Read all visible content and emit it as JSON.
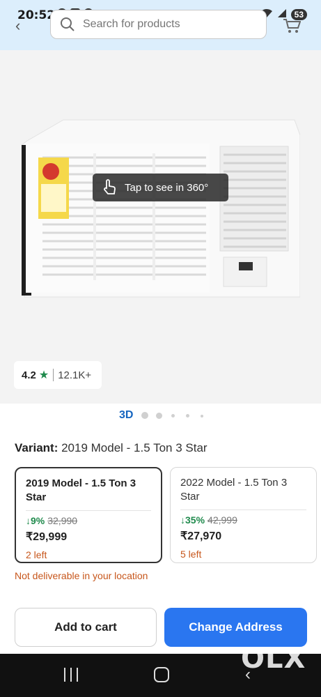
{
  "status_bar": {
    "time": "20:52",
    "battery": "53"
  },
  "header": {
    "search_placeholder": "Search for products"
  },
  "gallery": {
    "tap_360_label": "Tap to see in 360°",
    "rating": "4.2",
    "rating_star": "★",
    "rating_count": "12.1K+",
    "pager_label": "3D"
  },
  "variant": {
    "label": "Variant:",
    "selected": "2019 Model  -  1.5 Ton 3 Star",
    "options": [
      {
        "name": "2019 Model  -  1.5 Ton 3 Star",
        "discount": "↓9%",
        "mrp": "32,990",
        "price": "₹29,999",
        "stock": "2 left",
        "selected": true
      },
      {
        "name": "2022 Model  -  1.5 Ton 3 Star",
        "discount": "↓35%",
        "mrp": "42,999",
        "price": "₹27,970",
        "stock": "5 left",
        "selected": false
      }
    ]
  },
  "delivery_notice": "Not deliverable in your location",
  "actions": {
    "add_to_cart": "Add to cart",
    "change_address": "Change Address"
  },
  "watermark": "OLX",
  "colors": {
    "primary": "#2a76f0",
    "discount_green": "#1f8a4c",
    "warning_orange": "#c7561b",
    "header_bg": "#dceefc"
  }
}
